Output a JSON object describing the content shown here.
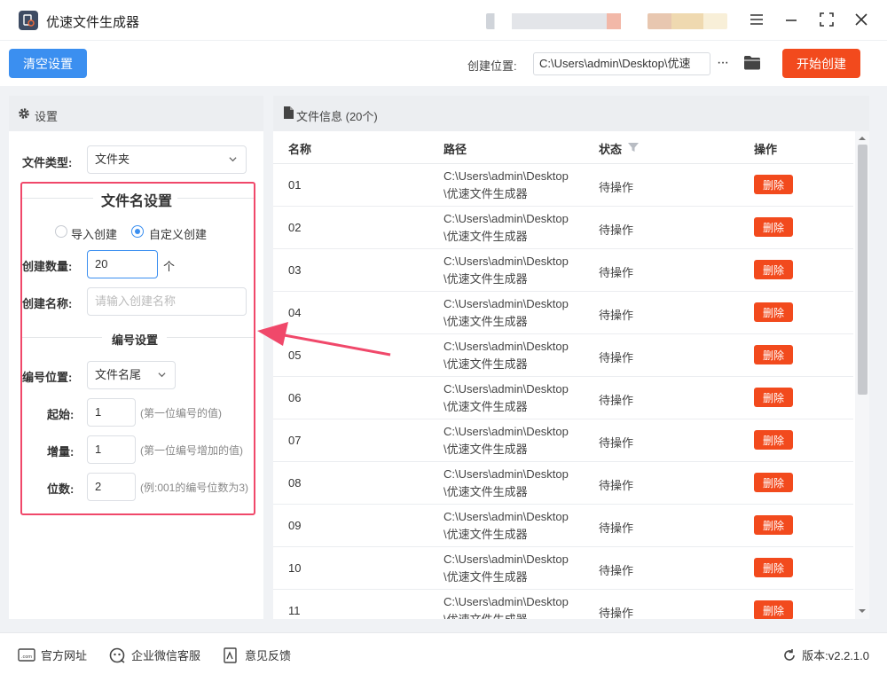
{
  "app": {
    "title": "优速文件生成器",
    "accent": "#3b8ff0",
    "danger": "#f24a1d"
  },
  "window_controls": [
    "menu-icon",
    "minimize-icon",
    "maximize-icon",
    "close-icon"
  ],
  "toolbar": {
    "clear_label": "清空设置",
    "location_label": "创建位置:",
    "location_value": "C:\\Users\\admin\\Desktop\\优速",
    "more_label": "···",
    "start_label": "开始创建"
  },
  "settings": {
    "header": "设置",
    "file_type_label": "文件类型:",
    "file_type_value": "文件夹",
    "filename_section": "文件名设置",
    "radio_import": "导入创建",
    "radio_custom": "自定义创建",
    "selected_mode": "自定义创建",
    "count_label": "创建数量:",
    "count_value": "20",
    "count_unit": "个",
    "name_label": "创建名称:",
    "name_placeholder": "请输入创建名称",
    "numbering_section": "编号设置",
    "position_label": "编号位置:",
    "position_value": "文件名尾",
    "start_label": "起始:",
    "start_value": "1",
    "start_hint": "(第一位编号的值)",
    "step_label": "增量:",
    "step_value": "1",
    "step_hint": "(第一位编号增加的值)",
    "digits_label": "位数:",
    "digits_value": "2",
    "digits_hint": "(例:001的编号位数为3)"
  },
  "file_info": {
    "header": "文件信息 (20个)",
    "columns": [
      "名称",
      "路径",
      "状态",
      "操作"
    ],
    "rows": [
      {
        "name": "01",
        "path": "C:\\Users\\admin\\Desktop\\优速文件生成器",
        "status": "待操作",
        "action": "删除"
      },
      {
        "name": "02",
        "path": "C:\\Users\\admin\\Desktop\\优速文件生成器",
        "status": "待操作",
        "action": "删除"
      },
      {
        "name": "03",
        "path": "C:\\Users\\admin\\Desktop\\优速文件生成器",
        "status": "待操作",
        "action": "删除"
      },
      {
        "name": "04",
        "path": "C:\\Users\\admin\\Desktop\\优速文件生成器",
        "status": "待操作",
        "action": "删除"
      },
      {
        "name": "05",
        "path": "C:\\Users\\admin\\Desktop\\优速文件生成器",
        "status": "待操作",
        "action": "删除"
      },
      {
        "name": "06",
        "path": "C:\\Users\\admin\\Desktop\\优速文件生成器",
        "status": "待操作",
        "action": "删除"
      },
      {
        "name": "07",
        "path": "C:\\Users\\admin\\Desktop\\优速文件生成器",
        "status": "待操作",
        "action": "删除"
      },
      {
        "name": "08",
        "path": "C:\\Users\\admin\\Desktop\\优速文件生成器",
        "status": "待操作",
        "action": "删除"
      },
      {
        "name": "09",
        "path": "C:\\Users\\admin\\Desktop\\优速文件生成器",
        "status": "待操作",
        "action": "删除"
      },
      {
        "name": "10",
        "path": "C:\\Users\\admin\\Desktop\\优速文件生成器",
        "status": "待操作",
        "action": "删除"
      },
      {
        "name": "11",
        "path": "C:\\Users\\admin\\Desktop\\优速文件生成器",
        "status": "待操作",
        "action": "删除"
      }
    ]
  },
  "footer": {
    "website": "官方网址",
    "wechat": "企业微信客服",
    "feedback": "意见反馈",
    "version": "版本:v2.2.1.0"
  }
}
